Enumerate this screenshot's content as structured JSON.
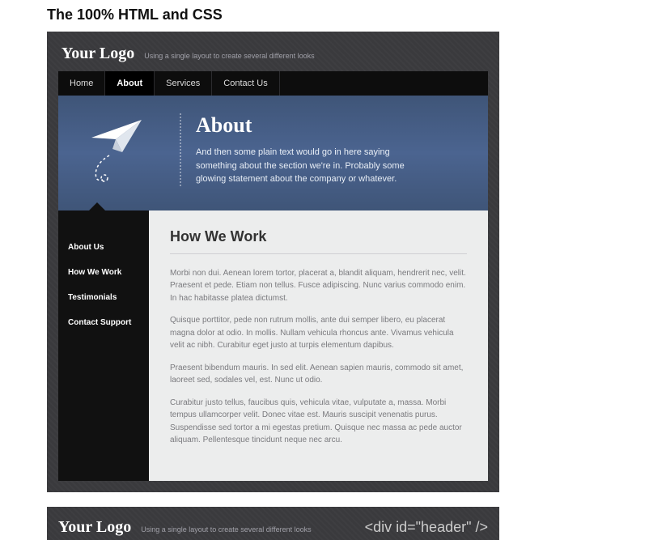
{
  "page_heading": "The 100% HTML and CSS",
  "header": {
    "logo": "Your Logo",
    "tagline": "Using a single layout to create several different looks"
  },
  "topnav": {
    "items": [
      {
        "label": "Home",
        "active": false
      },
      {
        "label": "About",
        "active": true
      },
      {
        "label": "Services",
        "active": false
      },
      {
        "label": "Contact Us",
        "active": false
      }
    ]
  },
  "hero": {
    "title": "About",
    "subtitle": "And then some plain text would go in here saying something about the section we're in. Probably some glowing statement about the company or whatever."
  },
  "sidebar": {
    "items": [
      {
        "label": "About Us"
      },
      {
        "label": "How We Work"
      },
      {
        "label": "Testimonials"
      },
      {
        "label": "Contact Support"
      }
    ]
  },
  "content": {
    "title": "How We Work",
    "paragraphs": [
      "Morbi non dui. Aenean lorem tortor, placerat a, blandit aliquam, hendrerit nec, velit. Praesent et pede. Etiam non tellus. Fusce adipiscing. Nunc varius commodo enim. In hac habitasse platea dictumst.",
      "Quisque porttitor, pede non rutrum mollis, ante dui semper libero, eu placerat magna dolor at odio. In mollis. Nullam vehicula rhoncus ante. Vivamus vehicula velit ac nibh. Curabitur eget justo at turpis elementum dapibus.",
      "Praesent bibendum mauris. In sed elit. Aenean sapien mauris, commodo sit amet, laoreet sed, sodales vel, est. Nunc ut odio.",
      "Curabitur justo tellus, faucibus quis, vehicula vitae, vulputate a, massa. Morbi tempus ullamcorper velit. Donec vitae est. Mauris suscipit venenatis purus. Suspendisse sed tortor a mi egestas pretium. Quisque nec massa ac pede auctor aliquam. Pellentesque tincidunt neque nec arcu."
    ]
  },
  "footer": {
    "logo": "Your Logo",
    "tagline": "Using a single layout to create several different looks",
    "code_label": "<div id=\"header\" />"
  }
}
